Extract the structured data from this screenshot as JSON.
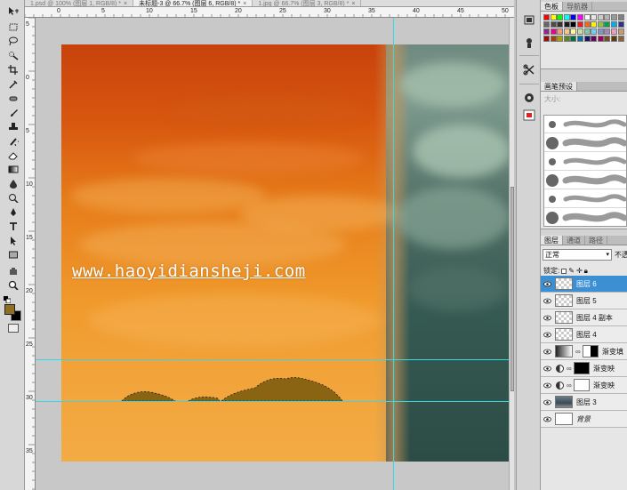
{
  "tabs": [
    {
      "label": "1.psd @ 100% (图层 1, RGB/8) *",
      "active": false
    },
    {
      "label": "未标题-3 @ 66.7% (图层 6, RGB/8) *",
      "active": true
    },
    {
      "label": "1.jpg @ 66.7% (图层 3, RGB/8) *",
      "active": false
    }
  ],
  "ruler_top_numbers": [
    "0",
    "5",
    "10",
    "15",
    "20",
    "25",
    "30",
    "35",
    "40",
    "45",
    "50"
  ],
  "ruler_left_numbers": [
    "5",
    "0",
    "5",
    "10",
    "15",
    "20",
    "25",
    "30",
    "35"
  ],
  "watermark": "www.haoyidiansheji.com",
  "colors": {
    "foreground": "#8f6f22",
    "background": "#000000",
    "guide": "#36d7e6",
    "layer_selected": "#3d8fd4"
  },
  "toolbar": {
    "icons": [
      "move-icon",
      "marquee-icon",
      "lasso-icon",
      "quick-select-icon",
      "crop-icon",
      "eyedropper-icon",
      "healing-brush-icon",
      "brush-icon",
      "clone-stamp-icon",
      "history-brush-icon",
      "eraser-icon",
      "gradient-icon",
      "blur-icon",
      "dodge-icon",
      "pen-icon",
      "type-icon",
      "path-select-icon",
      "shape-icon",
      "hand-icon",
      "zoom-icon"
    ]
  },
  "swatches_panel": {
    "tabs": [
      {
        "label": "色板",
        "active": true
      },
      {
        "label": "导航器",
        "active": false
      }
    ],
    "colors": [
      "#ff0000",
      "#ffff00",
      "#00ff00",
      "#00ffff",
      "#0000ff",
      "#ff00ff",
      "#ffffff",
      "#e6e6e6",
      "#cccccc",
      "#b3b3b3",
      "#999999",
      "#808080",
      "#666666",
      "#4d4d4d",
      "#333333",
      "#1a1a1a",
      "#000000",
      "#ed1c24",
      "#f26522",
      "#fff200",
      "#8dc63f",
      "#00a651",
      "#00aeef",
      "#2e3192",
      "#92278f",
      "#ec008c",
      "#f7977a",
      "#fdc689",
      "#fff799",
      "#c4df9b",
      "#82ca9c",
      "#6dcff6",
      "#8393ca",
      "#a187be",
      "#f49ac1",
      "#c69c6d",
      "#9e0b0f",
      "#a0410d",
      "#aba000",
      "#598527",
      "#007236",
      "#0076a3",
      "#1b1464",
      "#630460",
      "#9e005d",
      "#754c24",
      "#603913",
      "#8c6239"
    ]
  },
  "brushes_panel": {
    "tabs": [
      {
        "label": "画笔预设",
        "active": true
      }
    ],
    "option_text": "大小:"
  },
  "layers_panel": {
    "tabs": [
      {
        "label": "图层",
        "active": true
      },
      {
        "label": "通道",
        "active": false
      },
      {
        "label": "路径",
        "active": false
      }
    ],
    "blend_mode": "正常",
    "opacity_label": "不透",
    "lock_label": "锁定:",
    "layers": [
      {
        "name": "图层 6",
        "selected": true,
        "kind": "transparent"
      },
      {
        "name": "图层 5",
        "selected": false,
        "kind": "transparent"
      },
      {
        "name": "图层 4 副本",
        "selected": false,
        "kind": "transparent"
      },
      {
        "name": "图层 4",
        "selected": false,
        "kind": "transparent"
      },
      {
        "name": "渐变填",
        "selected": false,
        "kind": "gradient-fill"
      },
      {
        "name": "渐变映",
        "selected": false,
        "kind": "gradient-map"
      },
      {
        "name": "渐变映",
        "selected": false,
        "kind": "gradient-map-white"
      },
      {
        "name": "图层 3",
        "selected": false,
        "kind": "image"
      },
      {
        "name": "背景",
        "selected": false,
        "kind": "background"
      }
    ]
  }
}
